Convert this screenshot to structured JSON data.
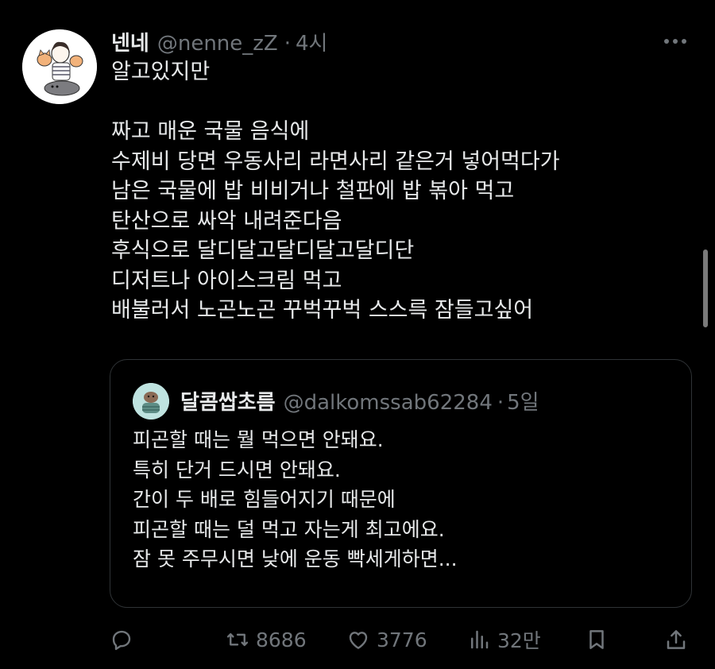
{
  "tweet": {
    "display_name": "넨네",
    "handle": "@nenne_zZ",
    "separator": "·",
    "time": "4시",
    "lines": [
      "알고있지만",
      "",
      "짜고 매운 국물 음식에",
      "수제비 당면 우동사리 라면사리 같은거 넣어먹다가",
      "남은 국물에 밥 비비거나 철판에 밥 볶아 먹고",
      "탄산으로 싸악 내려준다음",
      "후식으로 달디달고달디달고달디단",
      "디저트나 아이스크림 먹고",
      "배불러서 노곤노곤 꾸벅꾸벅 스스륵 잠들고싶어"
    ]
  },
  "quote": {
    "display_name": "달콤쌉초름",
    "handle": "@dalkomssab62284",
    "separator": "·",
    "time": "5일",
    "lines": [
      "피곤할 때는 뭘 먹으면 안돼요.",
      "특히 단거 드시면 안돼요.",
      "간이 두 배로 힘들어지기 때문에",
      "피곤할 때는 덜 먹고 자는게 최고에요.",
      "잠 못 주무시면 낮에 운동 빡세게하면..."
    ]
  },
  "actions": {
    "reply": {
      "icon": "reply-icon",
      "count": ""
    },
    "retweet": {
      "icon": "retweet-icon",
      "count": "8686"
    },
    "like": {
      "icon": "heart-icon",
      "count": "3776"
    },
    "views": {
      "icon": "views-icon",
      "count": "32만"
    },
    "bookmark": {
      "icon": "bookmark-icon"
    },
    "share": {
      "icon": "share-icon"
    }
  },
  "colors": {
    "background": "#000000",
    "text": "#e7e9ea",
    "secondary": "#71767b",
    "border": "#2f3336"
  }
}
